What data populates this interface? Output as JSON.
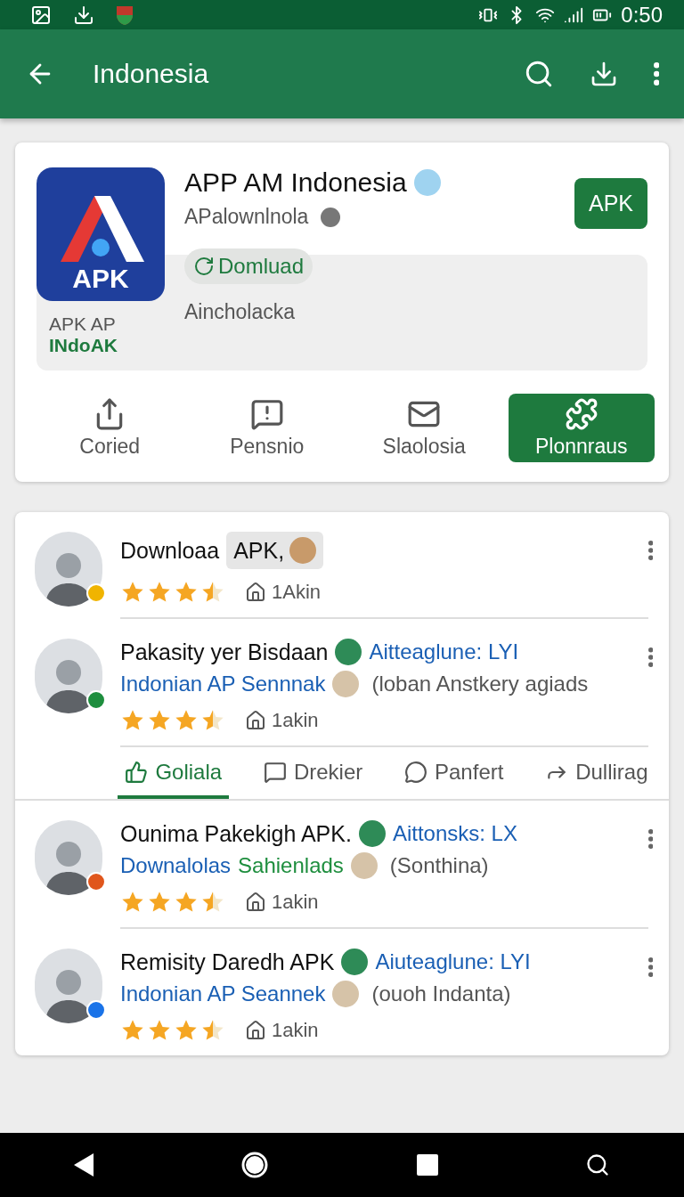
{
  "status_bar": {
    "time": "0:50"
  },
  "app_bar": {
    "title": "Indonesia"
  },
  "app_card": {
    "icon_label": "APK",
    "caption": [
      "APK AP",
      "INdoAK"
    ],
    "name": "APP AM Indonesia",
    "developer": "APalownlnola",
    "badge": "APK",
    "download": "Domluad",
    "subtitle": "Aincholacka",
    "actions": [
      {
        "label": "Coried",
        "selected": false
      },
      {
        "label": "Pensnio",
        "selected": false
      },
      {
        "label": "Slaolosia",
        "selected": false
      },
      {
        "label": "Plonnraus",
        "selected": true
      }
    ]
  },
  "feed": [
    {
      "kind": "review",
      "title": "Downloaa",
      "chip": "APK,",
      "stars": 3.5,
      "meta": "1Akin",
      "color": "#f0b400"
    },
    {
      "kind": "review",
      "title": "Pakasity yer Bisdaan",
      "tag": "Aitteaglune: LYI",
      "links": [
        {
          "text": "Indonian AP Sennnak",
          "color": "#1a5fb4"
        }
      ],
      "note": "(loban Anstkery agiads",
      "stars": 3.5,
      "meta": "1akin",
      "color": "#1e8e3e"
    },
    {
      "kind": "tabs",
      "tabs": [
        {
          "label": "Goliala",
          "selected": true
        },
        {
          "label": "Drekier",
          "selected": false
        },
        {
          "label": "Panfert",
          "selected": false
        },
        {
          "label": "Dullirag",
          "selected": false
        }
      ]
    },
    {
      "kind": "review",
      "title": "Ounima Pakekigh APK.",
      "tag": "Aittonsks: LX",
      "links": [
        {
          "text": "Downalolas",
          "color": "#1a5fb4"
        },
        {
          "text": "Sahienlads",
          "color": "#1e8e3e"
        }
      ],
      "note": "(Sonthina)",
      "stars": 3.5,
      "meta": "1akin",
      "color": "#e0561c"
    },
    {
      "kind": "review",
      "title": "Remisity Daredh APK",
      "tag": "Aiuteaglune: LYI",
      "links": [
        {
          "text": "Indonian AP Seannek",
          "color": "#1a5fb4"
        }
      ],
      "note": "(ouoh Indanta)",
      "stars": 3.5,
      "meta": "1akin",
      "color": "#1a73e8"
    }
  ]
}
